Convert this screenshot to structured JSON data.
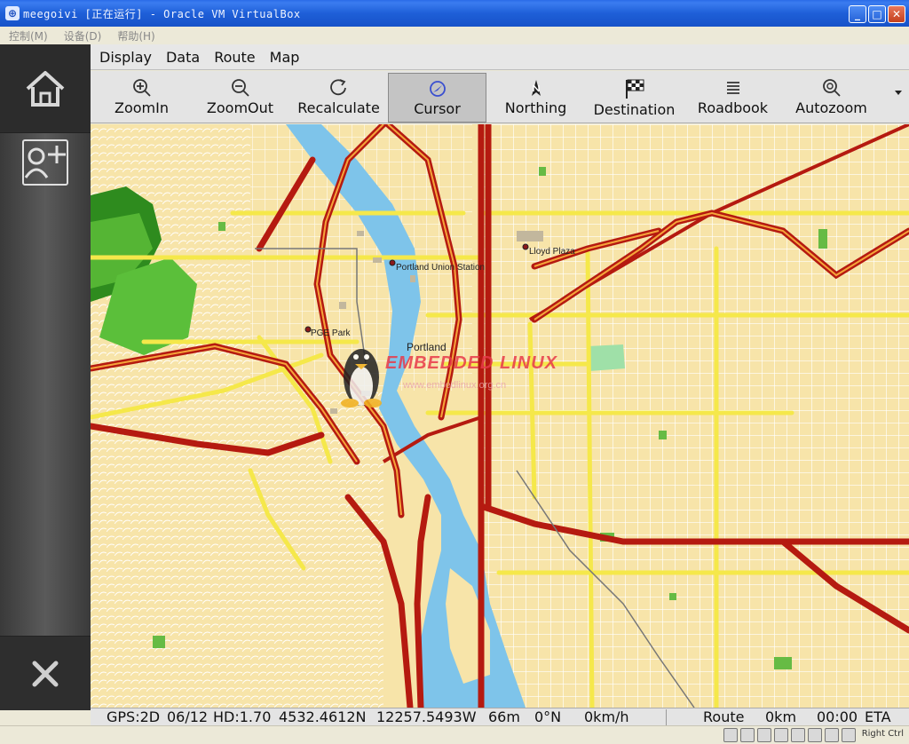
{
  "window": {
    "title": "meegoivi [正在运行] - Oracle VM VirtualBox",
    "icon": "virtualbox-icon",
    "minimize": "_",
    "maximize": "□",
    "close": "✕"
  },
  "vbox_menu": [
    {
      "label": "控制(M)"
    },
    {
      "label": "设备(D)"
    },
    {
      "label": "帮助(H)"
    }
  ],
  "sidebar": {
    "home_icon": "home-icon",
    "contact_icon": "add-contact-icon",
    "close_icon": "close-icon"
  },
  "app_menu": [
    {
      "label": "Display"
    },
    {
      "label": "Data"
    },
    {
      "label": "Route"
    },
    {
      "label": "Map"
    }
  ],
  "toolbar": [
    {
      "label": "ZoomIn",
      "icon": "zoom-in-icon"
    },
    {
      "label": "ZoomOut",
      "icon": "zoom-out-icon"
    },
    {
      "label": "Recalculate",
      "icon": "refresh-icon"
    },
    {
      "label": "Cursor",
      "icon": "cursor-icon",
      "active": true
    },
    {
      "label": "Northing",
      "icon": "north-arrow-icon"
    },
    {
      "label": "Destination",
      "icon": "checkered-flag-icon"
    },
    {
      "label": "Roadbook",
      "icon": "list-icon"
    },
    {
      "label": "Autozoom",
      "icon": "autozoom-icon"
    }
  ],
  "map": {
    "labels": {
      "union_station": "Portland Union Station",
      "lloyd_plaza": "Lloyd Plaza",
      "pge_park": "PGE Park",
      "portland": "Portland"
    },
    "watermark": "EMBEDDED LINUX",
    "watermark_url": "www.embedlinux.org.cn",
    "colors": {
      "land": "#f7e4a9",
      "river": "#7ec4ea",
      "major_road": "#b51a10",
      "road": "#f5e84a",
      "park": "#66bb44"
    }
  },
  "status": {
    "gps": "GPS:2D",
    "date": "06/12",
    "hd": "HD:1.70",
    "lat": "4532.4612N",
    "lon": "12257.5493W",
    "altitude": "66m",
    "heading": "0°N",
    "speed": "0km/h",
    "route_label": "Route",
    "route_distance": "0km",
    "eta_time": "00:00",
    "eta_label": "ETA"
  },
  "vbox_status": {
    "host_key": "Right Ctrl"
  }
}
